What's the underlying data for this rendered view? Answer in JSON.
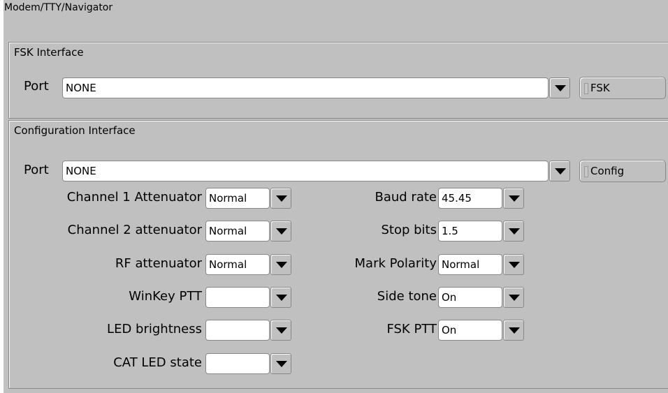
{
  "panel": {
    "title": "Modem/TTY/Navigator"
  },
  "fsk": {
    "title": "FSK Interface",
    "port_label": "Port",
    "port_value": "NONE",
    "button_label": "FSK"
  },
  "config": {
    "title": "Configuration Interface",
    "port_label": "Port",
    "port_value": "NONE",
    "button_label": "Config",
    "left": [
      {
        "label": "Channel 1 Attenuator",
        "value": "Normal"
      },
      {
        "label": "Channel 2 attenuator",
        "value": "Normal"
      },
      {
        "label": "RF attenuator",
        "value": "Normal"
      },
      {
        "label": "WinKey PTT",
        "value": ""
      },
      {
        "label": "LED brightness",
        "value": ""
      },
      {
        "label": "CAT LED state",
        "value": ""
      }
    ],
    "right": [
      {
        "label": "Baud rate",
        "value": "45.45"
      },
      {
        "label": "Stop bits",
        "value": "1.5"
      },
      {
        "label": "Mark Polarity",
        "value": "Normal"
      },
      {
        "label": "Side tone",
        "value": "On"
      },
      {
        "label": "FSK PTT",
        "value": "On"
      }
    ]
  }
}
